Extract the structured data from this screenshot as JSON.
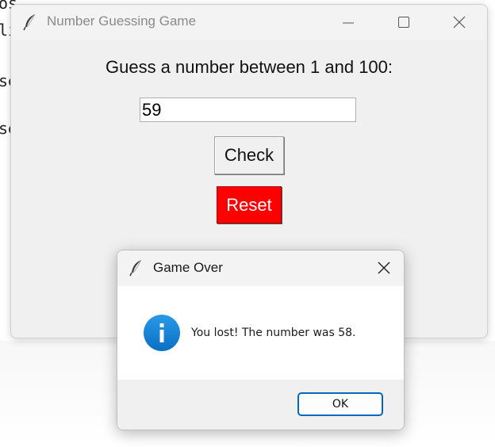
{
  "background": {
    "terminal_fragments": [
      "os",
      "li",
      "se",
      "se"
    ]
  },
  "main_window": {
    "title": "Number Guessing Game",
    "prompt": "Guess a number between 1 and 100:",
    "guess_value": "59",
    "check_label": "Check",
    "reset_label": "Reset",
    "reset_color": "#ff0000"
  },
  "dialog": {
    "title": "Game Over",
    "icon": "info-icon",
    "message": "You lost! The number was 58.",
    "ok_label": "OK",
    "accent_color": "#0067c0"
  }
}
